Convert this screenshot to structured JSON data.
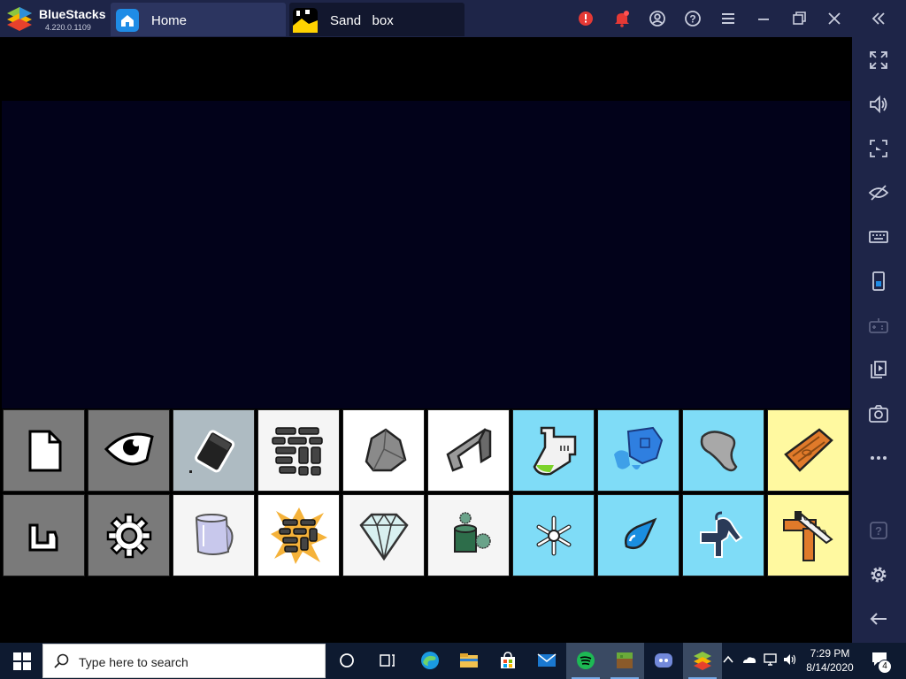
{
  "app": {
    "name": "BlueStacks",
    "version": "4.220.0.1109"
  },
  "tabs": [
    {
      "label": "Home",
      "icon": "home-icon"
    },
    {
      "label": "Sand   box",
      "icon": "sandbox-app-icon"
    }
  ],
  "titlebar_icons": [
    "alert-icon",
    "notification-bell-icon",
    "account-icon",
    "help-icon",
    "menu-icon",
    "minimize-icon",
    "restore-icon",
    "close-icon",
    "collapse-sidebar-icon"
  ],
  "sidebar_icons": [
    "fullscreen-icon",
    "volume-icon",
    "screenshot-region-icon",
    "eye-hidden-icon",
    "keyboard-icon",
    "phone-portrait-icon",
    "gamepad-icon",
    "media-import-icon",
    "camera-icon",
    "more-icon",
    "sidebar-help-icon",
    "sidebar-settings-icon",
    "back-arrow-icon"
  ],
  "palette": {
    "row1": [
      {
        "name": "new-file-tool",
        "bg": "#7a7a7a"
      },
      {
        "name": "eye-view-tool",
        "bg": "#7a7a7a"
      },
      {
        "name": "eraser-element",
        "bg": "#aebbc2"
      },
      {
        "name": "wall-element",
        "bg": "#f5f5f5"
      },
      {
        "name": "stone-element",
        "bg": "#ffffff"
      },
      {
        "name": "metal-element",
        "bg": "#ffffff"
      },
      {
        "name": "acid-element",
        "bg": "#7fdcf7"
      },
      {
        "name": "ice-element",
        "bg": "#7fdcf7"
      },
      {
        "name": "putty-element",
        "bg": "#7fdcf7"
      },
      {
        "name": "wood-element",
        "bg": "#fff9a0"
      }
    ],
    "row2": [
      {
        "name": "load-tool",
        "bg": "#7a7a7a"
      },
      {
        "name": "settings-tool",
        "bg": "#7a7a7a"
      },
      {
        "name": "glass-element",
        "bg": "#f5f5f5"
      },
      {
        "name": "explosive-wall-element",
        "bg": "#ffffff"
      },
      {
        "name": "diamond-element",
        "bg": "#f5f5f5"
      },
      {
        "name": "moss-element",
        "bg": "#f5f5f5"
      },
      {
        "name": "snow-element",
        "bg": "#7fdcf7"
      },
      {
        "name": "water-drop-element",
        "bg": "#7fdcf7"
      },
      {
        "name": "pipe-element",
        "bg": "#7fdcf7"
      },
      {
        "name": "saw-wood-element",
        "bg": "#fff9a0"
      }
    ]
  },
  "taskbar": {
    "search_placeholder": "Type here to search",
    "apps": [
      "task-view-icon",
      "edge-icon",
      "file-explorer-icon",
      "store-icon",
      "mail-icon",
      "spotify-icon",
      "minecraft-icon",
      "discord-icon",
      "bluestacks-icon"
    ],
    "time": "7:29 PM",
    "date": "8/14/2020",
    "notification_count": "4"
  },
  "colors": {
    "titlebar": "#1e2548",
    "canvas": "#02021a",
    "taskbar": "#0e1a30"
  }
}
